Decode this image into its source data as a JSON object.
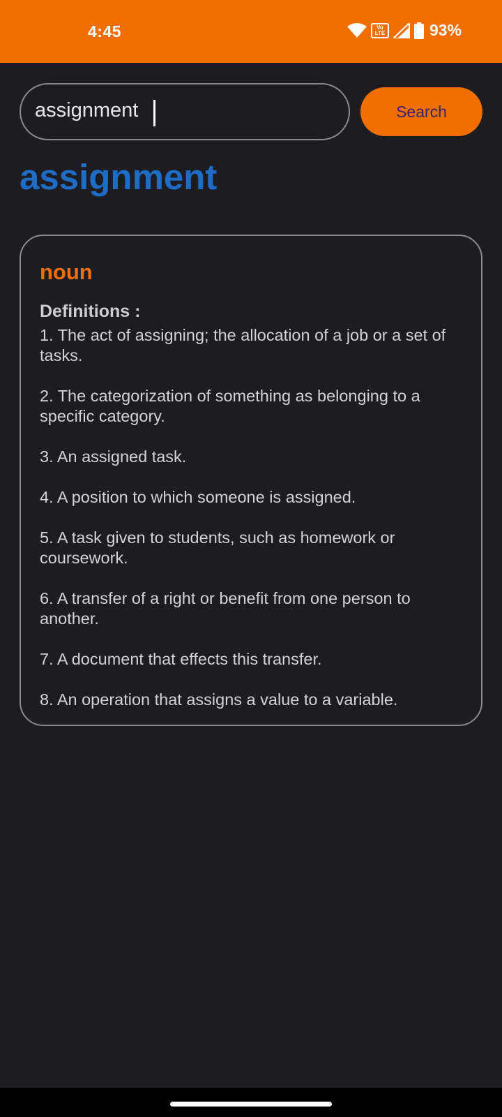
{
  "status_bar": {
    "time": "4:45",
    "volte_label": "Vo\nLTE",
    "battery": "93%",
    "icons": [
      "wifi-icon",
      "volte-icon",
      "signal-icon",
      "battery-icon"
    ],
    "background": "#f06f00"
  },
  "search": {
    "value": "assignment",
    "button_label": "Search"
  },
  "result": {
    "word": "assignment",
    "part_of_speech": "noun",
    "definitions_heading": "Definitions :",
    "definitions": [
      "1. The act of assigning; the allocation of a job or a set of tasks.",
      "2. The categorization of something as belonging to a specific category.",
      "3. An assigned task.",
      "4. A position to which someone is assigned.",
      "5. A task given to students, such as homework or coursework.",
      "6. A transfer of a right or benefit from one person to another.",
      "7. A document that effects this transfer.",
      "8. An operation that assigns a value to a variable."
    ]
  },
  "colors": {
    "accent": "#f06f00",
    "word_title": "#1f6cc6",
    "background": "#1d1c21"
  }
}
